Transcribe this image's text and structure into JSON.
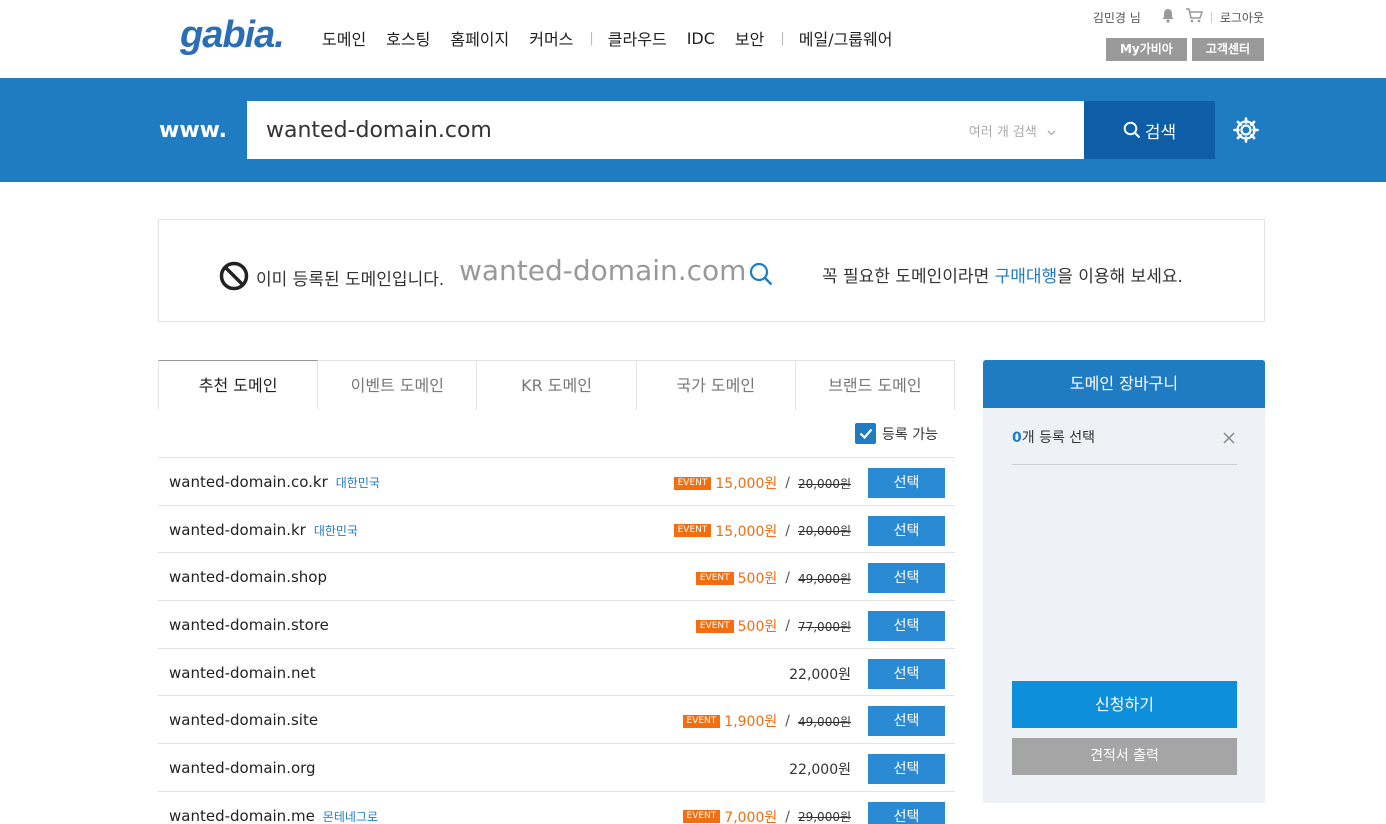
{
  "header": {
    "logo": "gabia.",
    "nav": [
      "도메인",
      "호스팅",
      "홈페이지",
      "커머스",
      "클라우드",
      "IDC",
      "보안",
      "메일/그룹웨어"
    ],
    "user": "김민경 님",
    "logout": "로그아웃",
    "my_gabia": "My가비아",
    "support": "고객센터"
  },
  "search": {
    "prefix": "www.",
    "value": "wanted-domain.com",
    "multi": "여러 개 검색",
    "button": "검색"
  },
  "notice": {
    "status": "이미 등록된 도메인입니다.",
    "domain": "wanted-domain.com",
    "right_pre": "꼭 필요한 도메인이라면 ",
    "right_link": "구매대행",
    "right_post": "을 이용해 보세요."
  },
  "tabs": [
    "추천 도메인",
    "이벤트 도메인",
    "KR 도메인",
    "국가 도메인",
    "브랜드 도메인"
  ],
  "filter": {
    "label": "등록 가능",
    "checked": true
  },
  "domains": [
    {
      "name": "wanted-domain.co.kr",
      "country": "대한민국",
      "event": "EVENT",
      "price": "15,000원",
      "original": "20,000원",
      "button": "선택"
    },
    {
      "name": "wanted-domain.kr",
      "country": "대한민국",
      "event": "EVENT",
      "price": "15,000원",
      "original": "20,000원",
      "button": "선택"
    },
    {
      "name": "wanted-domain.shop",
      "country": "",
      "event": "EVENT",
      "price": "500원",
      "original": "49,000원",
      "button": "선택"
    },
    {
      "name": "wanted-domain.store",
      "country": "",
      "event": "EVENT",
      "price": "500원",
      "original": "77,000원",
      "button": "선택"
    },
    {
      "name": "wanted-domain.net",
      "country": "",
      "event": "",
      "price": "22,000원",
      "original": "",
      "button": "선택"
    },
    {
      "name": "wanted-domain.site",
      "country": "",
      "event": "EVENT",
      "price": "1,900원",
      "original": "49,000원",
      "button": "선택"
    },
    {
      "name": "wanted-domain.org",
      "country": "",
      "event": "",
      "price": "22,000원",
      "original": "",
      "button": "선택"
    },
    {
      "name": "wanted-domain.me",
      "country": "몬테네그로",
      "event": "EVENT",
      "price": "7,000원",
      "original": "29,000원",
      "button": "선택"
    }
  ],
  "cart": {
    "title": "도메인 장바구니",
    "count": "0",
    "count_suffix": "개 등록 선택",
    "apply": "신청하기",
    "quote": "견적서 출력"
  },
  "colors": {
    "brand": "#1f7cc2",
    "event": "#f26e10",
    "button": "#2a8ad4"
  }
}
